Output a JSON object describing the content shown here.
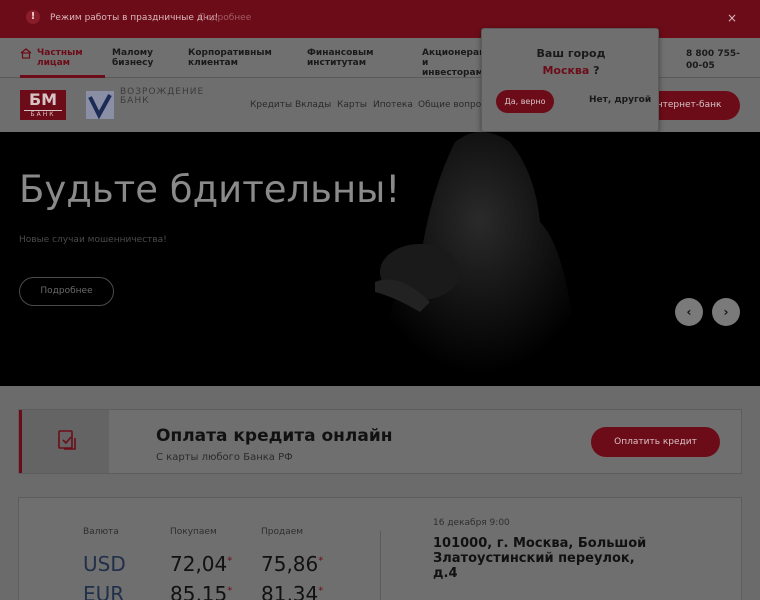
{
  "notice": {
    "icon": "exclamation-icon",
    "text": "Режим работы в праздничные дни!",
    "link": "Подробнее",
    "close": "×"
  },
  "segments": {
    "items": [
      {
        "label": "Частным лицам",
        "active": true
      },
      {
        "label": "Малому бизнесу"
      },
      {
        "label": "Корпоративным клиентам"
      },
      {
        "label": "Финансовым институтам"
      },
      {
        "label": "Акционерам и инвесторам"
      }
    ],
    "phone": "8 800 755-00-05"
  },
  "header": {
    "bm_logo": {
      "big": "БМ",
      "small": "БАНК"
    },
    "voz_logo": {
      "line1": "ВОЗРОЖДЕНИЕ",
      "line2": "БАНК"
    },
    "nav": [
      "Кредиты",
      "Вклады",
      "Карты",
      "Ипотека",
      "Общие вопросы"
    ],
    "internet_bank": "Интернет-банк"
  },
  "city_popup": {
    "question": "Ваш город",
    "city": "Москва",
    "question_mark": "?",
    "yes": "Да, верно",
    "no": "Нет, другой"
  },
  "hero": {
    "title": "Будьте бдительны!",
    "subtitle": "Новые случаи мошенничества!",
    "button": "Подробнее",
    "prev": "‹",
    "next": "›"
  },
  "payment": {
    "title": "Оплата кредита онлайн",
    "subtitle": "С карты любого Банка РФ",
    "button": "Оплатить кредит"
  },
  "rates": {
    "headers": {
      "currency": "Валюта",
      "buy": "Покупаем",
      "sell": "Продаем"
    },
    "rows": [
      {
        "code": "USD",
        "buy": "72,04",
        "sell": "75,86"
      },
      {
        "code": "EUR",
        "buy": "85,15",
        "sell": "81,34"
      }
    ],
    "date": "16 декабря 9:00",
    "address": "101000, г. Москва, Большой Златоустинский переулок, д.4"
  },
  "colors": {
    "brand": "#6c0c18"
  }
}
